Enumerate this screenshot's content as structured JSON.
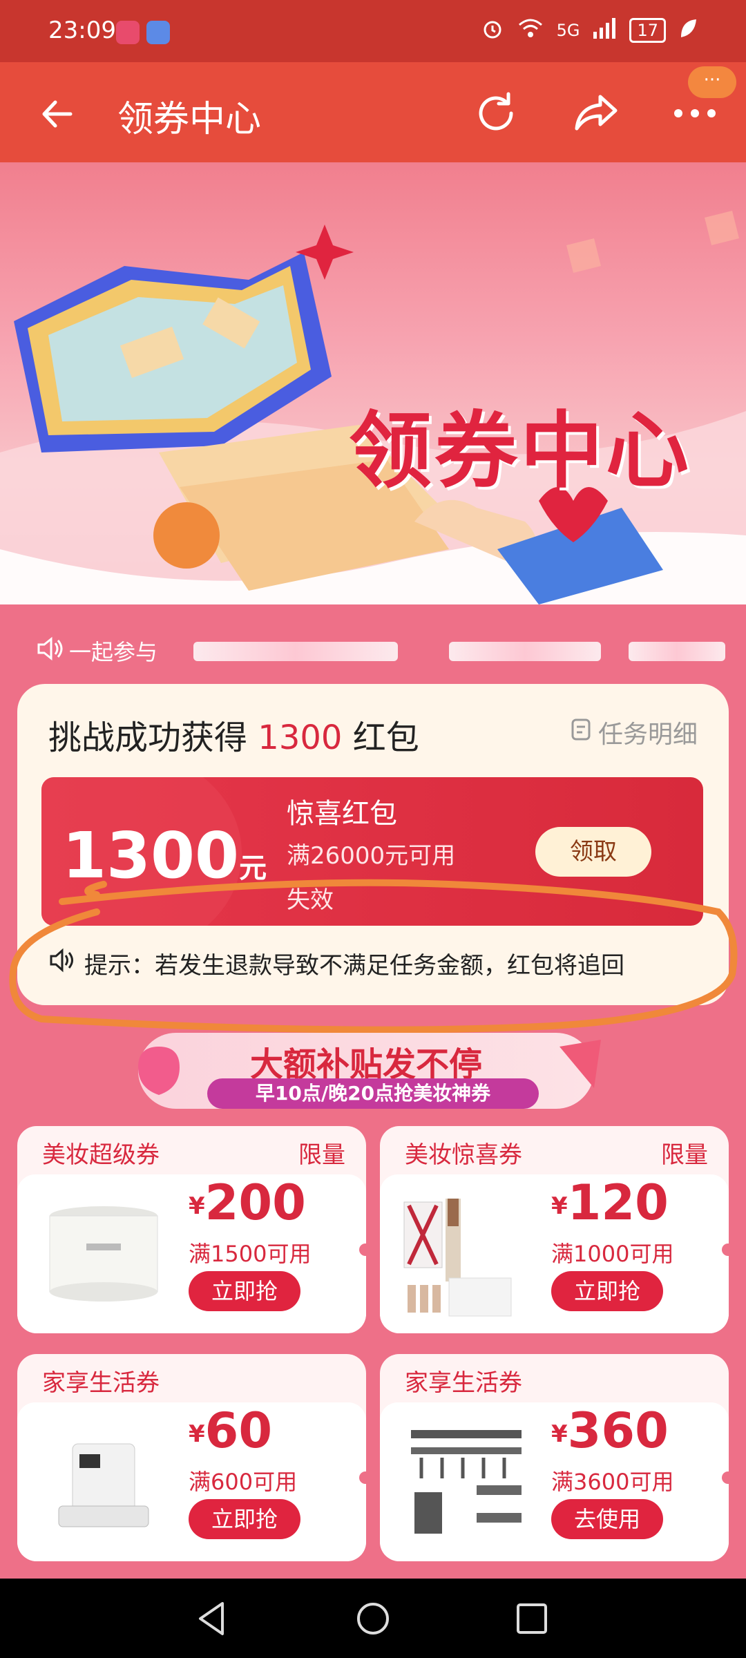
{
  "status_bar": {
    "time": "23:09",
    "network": "5G",
    "battery": "17"
  },
  "app_bar": {
    "title": "领券中心",
    "icons": [
      "back-arrow-icon",
      "refresh-icon",
      "share-icon",
      "more-icon"
    ],
    "more_badge": "···"
  },
  "banner": {
    "title": "领券中心"
  },
  "marquee": {
    "label": "一起参与"
  },
  "challenge": {
    "head_prefix": "挑战成功获得",
    "head_amount": "1300",
    "head_suffix": "红包",
    "detail_link": "任务明细",
    "coupon": {
      "amount": "1300",
      "unit": "元",
      "name": "惊喜红包",
      "condition": "满26000元可用",
      "expire": "失效",
      "claim_label": "领取"
    },
    "tip": "提示：若发生退款导致不满足任务金额，红包将追回"
  },
  "subsidy": {
    "title": "大额补贴发不停",
    "subtitle": "早10点/晚20点抢美妆神券"
  },
  "tiles": [
    {
      "name": "美妆超级券",
      "badge": "限量",
      "currency": "¥",
      "price": "200",
      "condition": "满1500可用",
      "button": "立即抢",
      "image": "cream-jar"
    },
    {
      "name": "美妆惊喜券",
      "badge": "限量",
      "currency": "¥",
      "price": "120",
      "condition": "满1000可用",
      "button": "立即抢",
      "image": "skincare-set"
    },
    {
      "name": "家享生活券",
      "badge": "",
      "currency": "¥",
      "price": "60",
      "condition": "满600可用",
      "button": "立即抢",
      "image": "robot-vacuum"
    },
    {
      "name": "家享生活券",
      "badge": "",
      "currency": "¥",
      "price": "360",
      "condition": "满3600可用",
      "button": "去使用",
      "image": "bathroom-rack"
    }
  ],
  "colors": {
    "accent": "#e0243f",
    "appbar": "#e64c3c",
    "statusbar": "#c8362e",
    "page_bg": "#ee7088",
    "annotation": "#f0883a"
  }
}
